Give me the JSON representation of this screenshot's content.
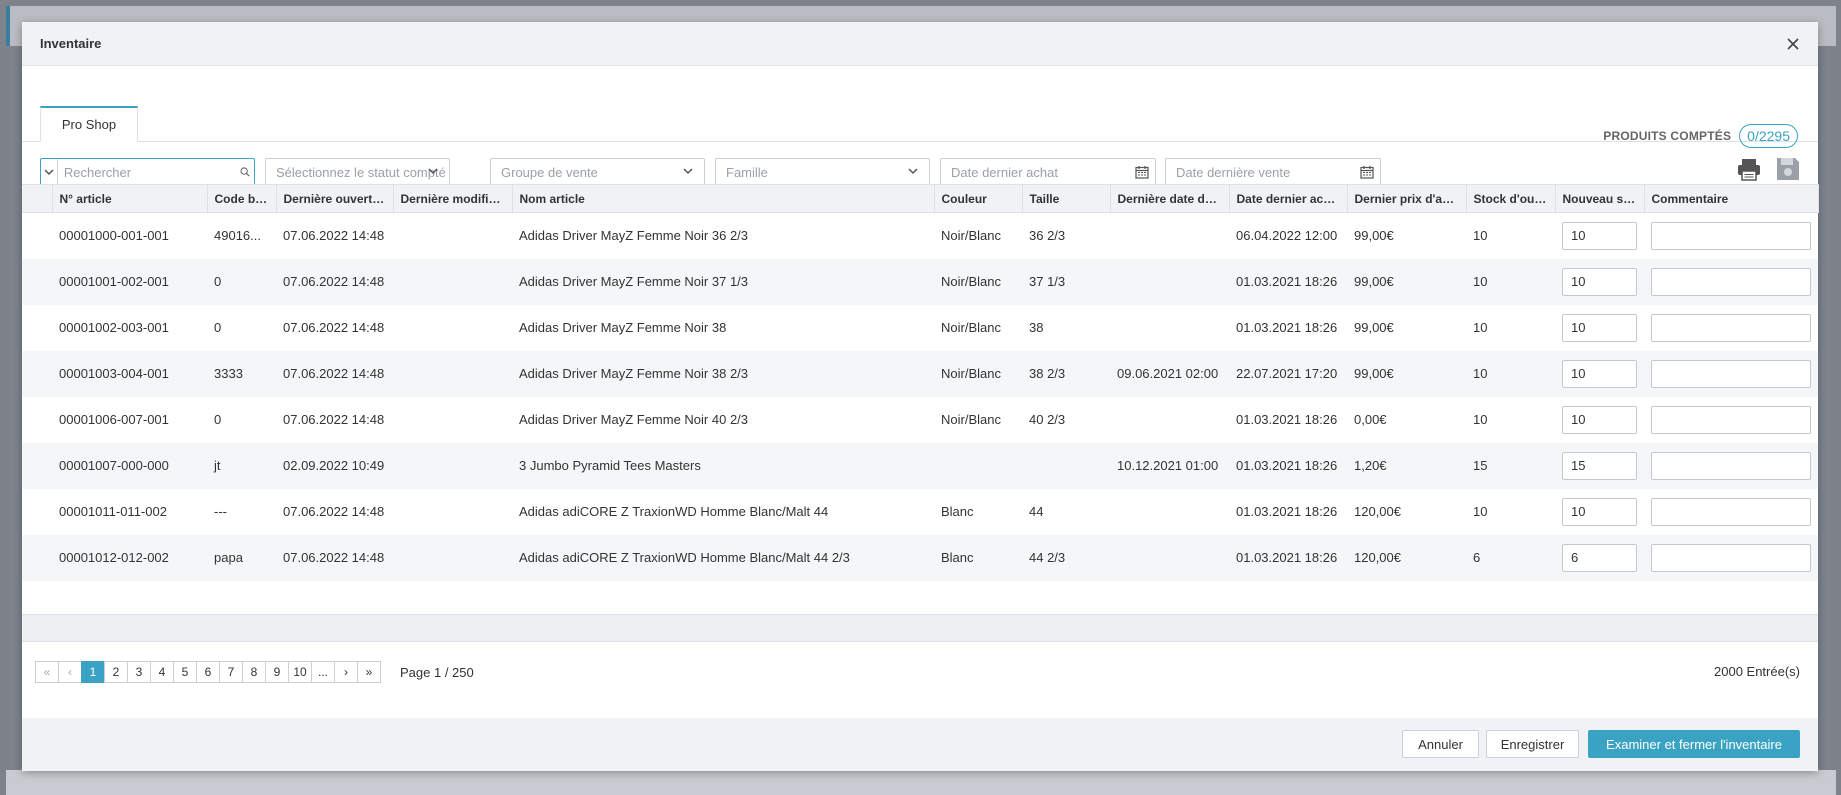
{
  "modal": {
    "title": "Inventaire"
  },
  "tab": {
    "label": "Pro Shop"
  },
  "counted": {
    "label": "PRODUITS COMPTÉS",
    "value": "0/2295"
  },
  "filters": {
    "search_placeholder": "Rechercher",
    "status_placeholder": "Sélectionnez le statut compté",
    "group_placeholder": "Groupe de vente",
    "family_placeholder": "Famille",
    "last_purchase_placeholder": "Date dernier achat",
    "last_sale_placeholder": "Date dernière vente"
  },
  "table": {
    "headers": [
      "N° article",
      "Code barre",
      "Dernière ouverture",
      "Dernière modificat...",
      "Nom article",
      "Couleur",
      "Taille",
      "Dernière date de v...",
      "Date dernier achat",
      "Dernier prix d'achat",
      "Stock d'ouve...",
      "Nouveau sto...",
      "Commentaire"
    ],
    "rows": [
      {
        "num": "00001000-001-001",
        "barcode": "49016...",
        "opened": "07.06.2022 14:48",
        "modified": "",
        "name": "Adidas Driver MayZ Femme Noir 36 2/3",
        "color": "Noir/Blanc",
        "size": "36 2/3",
        "last_sale": "",
        "last_purchase": "06.04.2022 12:00",
        "price": "99,00€",
        "stock": "10",
        "new_stock": "10",
        "comment": ""
      },
      {
        "num": "00001001-002-001",
        "barcode": "0",
        "opened": "07.06.2022 14:48",
        "modified": "",
        "name": "Adidas Driver MayZ Femme Noir 37 1/3",
        "color": "Noir/Blanc",
        "size": "37 1/3",
        "last_sale": "",
        "last_purchase": "01.03.2021 18:26",
        "price": "99,00€",
        "stock": "10",
        "new_stock": "10",
        "comment": ""
      },
      {
        "num": "00001002-003-001",
        "barcode": "0",
        "opened": "07.06.2022 14:48",
        "modified": "",
        "name": "Adidas Driver MayZ Femme Noir 38",
        "color": "Noir/Blanc",
        "size": "38",
        "last_sale": "",
        "last_purchase": "01.03.2021 18:26",
        "price": "99,00€",
        "stock": "10",
        "new_stock": "10",
        "comment": ""
      },
      {
        "num": "00001003-004-001",
        "barcode": "3333",
        "opened": "07.06.2022 14:48",
        "modified": "",
        "name": "Adidas Driver MayZ Femme Noir 38 2/3",
        "color": "Noir/Blanc",
        "size": "38 2/3",
        "last_sale": "09.06.2021 02:00",
        "last_purchase": "22.07.2021 17:20",
        "price": "99,00€",
        "stock": "10",
        "new_stock": "10",
        "comment": ""
      },
      {
        "num": "00001006-007-001",
        "barcode": "0",
        "opened": "07.06.2022 14:48",
        "modified": "",
        "name": "Adidas Driver MayZ Femme Noir 40 2/3",
        "color": "Noir/Blanc",
        "size": "40 2/3",
        "last_sale": "",
        "last_purchase": "01.03.2021 18:26",
        "price": "0,00€",
        "stock": "10",
        "new_stock": "10",
        "comment": ""
      },
      {
        "num": "00001007-000-000",
        "barcode": "jt",
        "opened": "02.09.2022 10:49",
        "modified": "",
        "name": "3 Jumbo Pyramid Tees Masters",
        "color": "",
        "size": "",
        "last_sale": "10.12.2021 01:00",
        "last_purchase": "01.03.2021 18:26",
        "price": "1,20€",
        "stock": "15",
        "new_stock": "15",
        "comment": ""
      },
      {
        "num": "00001011-011-002",
        "barcode": "---",
        "opened": "07.06.2022 14:48",
        "modified": "",
        "name": "Adidas adiCORE Z TraxionWD Homme Blanc/Malt 44",
        "color": "Blanc",
        "size": "44",
        "last_sale": "",
        "last_purchase": "01.03.2021 18:26",
        "price": "120,00€",
        "stock": "10",
        "new_stock": "10",
        "comment": ""
      },
      {
        "num": "00001012-012-002",
        "barcode": "papa",
        "opened": "07.06.2022 14:48",
        "modified": "",
        "name": "Adidas adiCORE Z TraxionWD Homme Blanc/Malt 44 2/3",
        "color": "Blanc",
        "size": "44 2/3",
        "last_sale": "",
        "last_purchase": "01.03.2021 18:26",
        "price": "120,00€",
        "stock": "6",
        "new_stock": "6",
        "comment": ""
      }
    ]
  },
  "pagination": {
    "first": "«",
    "prev": "‹",
    "next": "›",
    "last": "»",
    "pages": [
      "1",
      "2",
      "3",
      "4",
      "5",
      "6",
      "7",
      "8",
      "9",
      "10",
      "..."
    ],
    "current": "1",
    "info": "Page 1 / 250",
    "entries": "2000 Entrée(s)"
  },
  "footer": {
    "cancel": "Annuler",
    "save": "Enregistrer",
    "review_close": "Examiner et fermer l'inventaire"
  },
  "colors": {
    "accent": "#3aa3c4",
    "header_bg": "#f0f2f5"
  },
  "icons": [
    "close-icon",
    "search-icon",
    "chevron-down-icon",
    "calendar-icon",
    "print-icon",
    "save-icon"
  ]
}
